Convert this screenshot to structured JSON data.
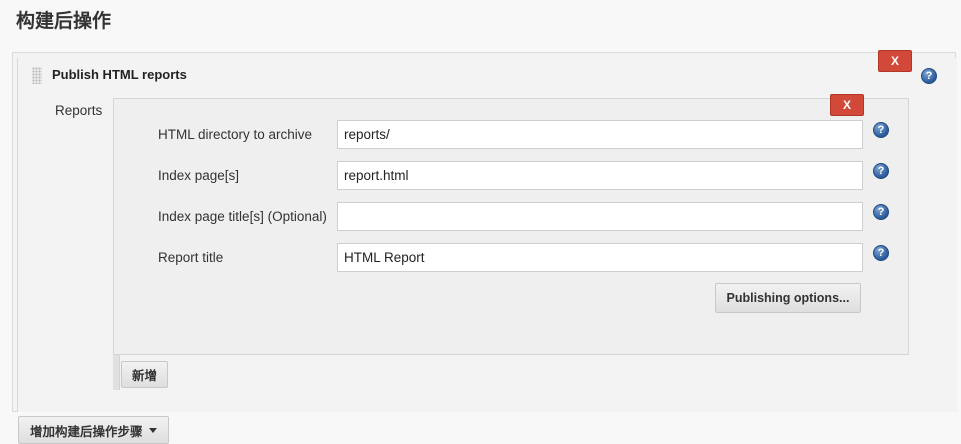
{
  "section": {
    "title": "构建后操作"
  },
  "step": {
    "title": "Publish HTML reports",
    "delete_label": "X"
  },
  "reports": {
    "label": "Reports",
    "delete_label": "X",
    "fields": [
      {
        "label": "HTML directory to archive",
        "value": "reports/"
      },
      {
        "label": "Index page[s]",
        "value": "report.html"
      },
      {
        "label": "Index page title[s] (Optional)",
        "value": ""
      },
      {
        "label": "Report title",
        "value": "HTML Report"
      }
    ],
    "publishing_options_label": "Publishing options...",
    "add_label": "新增"
  },
  "footer": {
    "add_step_label": "增加构建后操作步骤"
  },
  "help_glyph": "?",
  "colors": {
    "delete_button": "#d24939",
    "help_icon": "#2a5a99",
    "background": "#f8f8f8"
  },
  "icons": [
    "grip-handle-icon",
    "help-icon",
    "dropdown-caret-icon"
  ]
}
